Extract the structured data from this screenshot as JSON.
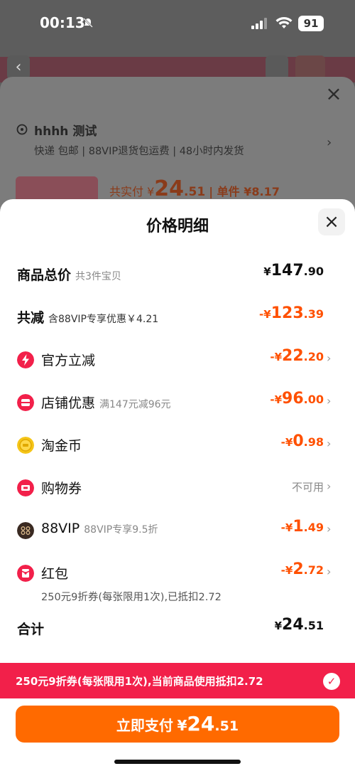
{
  "status": {
    "time": "00:13",
    "battery": "91"
  },
  "background_sheet": {
    "address_name": "hhhh 测试",
    "address_sub": "快递 包邮 | 88VIP退货包运费 | 48小时内发货",
    "paid_label": "共实付",
    "paid_symbol": "¥",
    "paid_int": "24",
    "paid_cents": ".51",
    "unit_price": "| 单件 ¥8.17"
  },
  "modal": {
    "title": "价格明细",
    "rows": [
      {
        "label": "商品总价",
        "note": "共3件宝贝",
        "sym": "¥",
        "int": "147",
        "cents": ".90"
      },
      {
        "label": "共减",
        "note": "含88VIP专享优惠￥4.21",
        "sym": "-¥",
        "int": "123",
        "cents": ".39"
      },
      {
        "label": "官方立减",
        "note": "",
        "sym": "-¥",
        "int": "22",
        "cents": ".20",
        "icon": "lightning-icon",
        "icon_color": "#f2204a"
      },
      {
        "label": "店铺优惠",
        "note": "满147元减96元",
        "sym": "-¥",
        "int": "96",
        "cents": ".00",
        "icon": "store-coupon-icon",
        "icon_color": "#f2204a"
      },
      {
        "label": "淘金币",
        "note": "",
        "sym": "-¥",
        "int": "0",
        "cents": ".98",
        "icon": "gold-coin-icon",
        "icon_color": "#f5c518"
      },
      {
        "label": "购物券",
        "note": "",
        "value_text": "不可用",
        "icon": "ticket-icon",
        "icon_color": "#f2204a"
      },
      {
        "label": "88VIP",
        "note": "88VIP专享9.5折",
        "sym": "-¥",
        "int": "1",
        "cents": ".49",
        "icon": "vip-88-icon",
        "icon_color": "#3a2a22"
      },
      {
        "label": "红包",
        "note": "",
        "sym": "-¥",
        "int": "2",
        "cents": ".72",
        "icon": "red-packet-icon",
        "icon_color": "#f2204a"
      }
    ],
    "hongbao_note": "250元9折券(每张限用1次),已抵扣2.72",
    "total_label": "合计",
    "total_sym": "¥",
    "total_int": "24",
    "total_cents": ".51"
  },
  "promo_bar": {
    "text": "250元9折券(每张限用1次),当前商品使用抵扣2.72",
    "bg": "#f2204a"
  },
  "pay_button": {
    "label": "立即支付",
    "sym": "¥",
    "int": "24",
    "cents": ".51",
    "bg": "#ff6a00"
  },
  "colors": {
    "discount": "#ff5000"
  }
}
